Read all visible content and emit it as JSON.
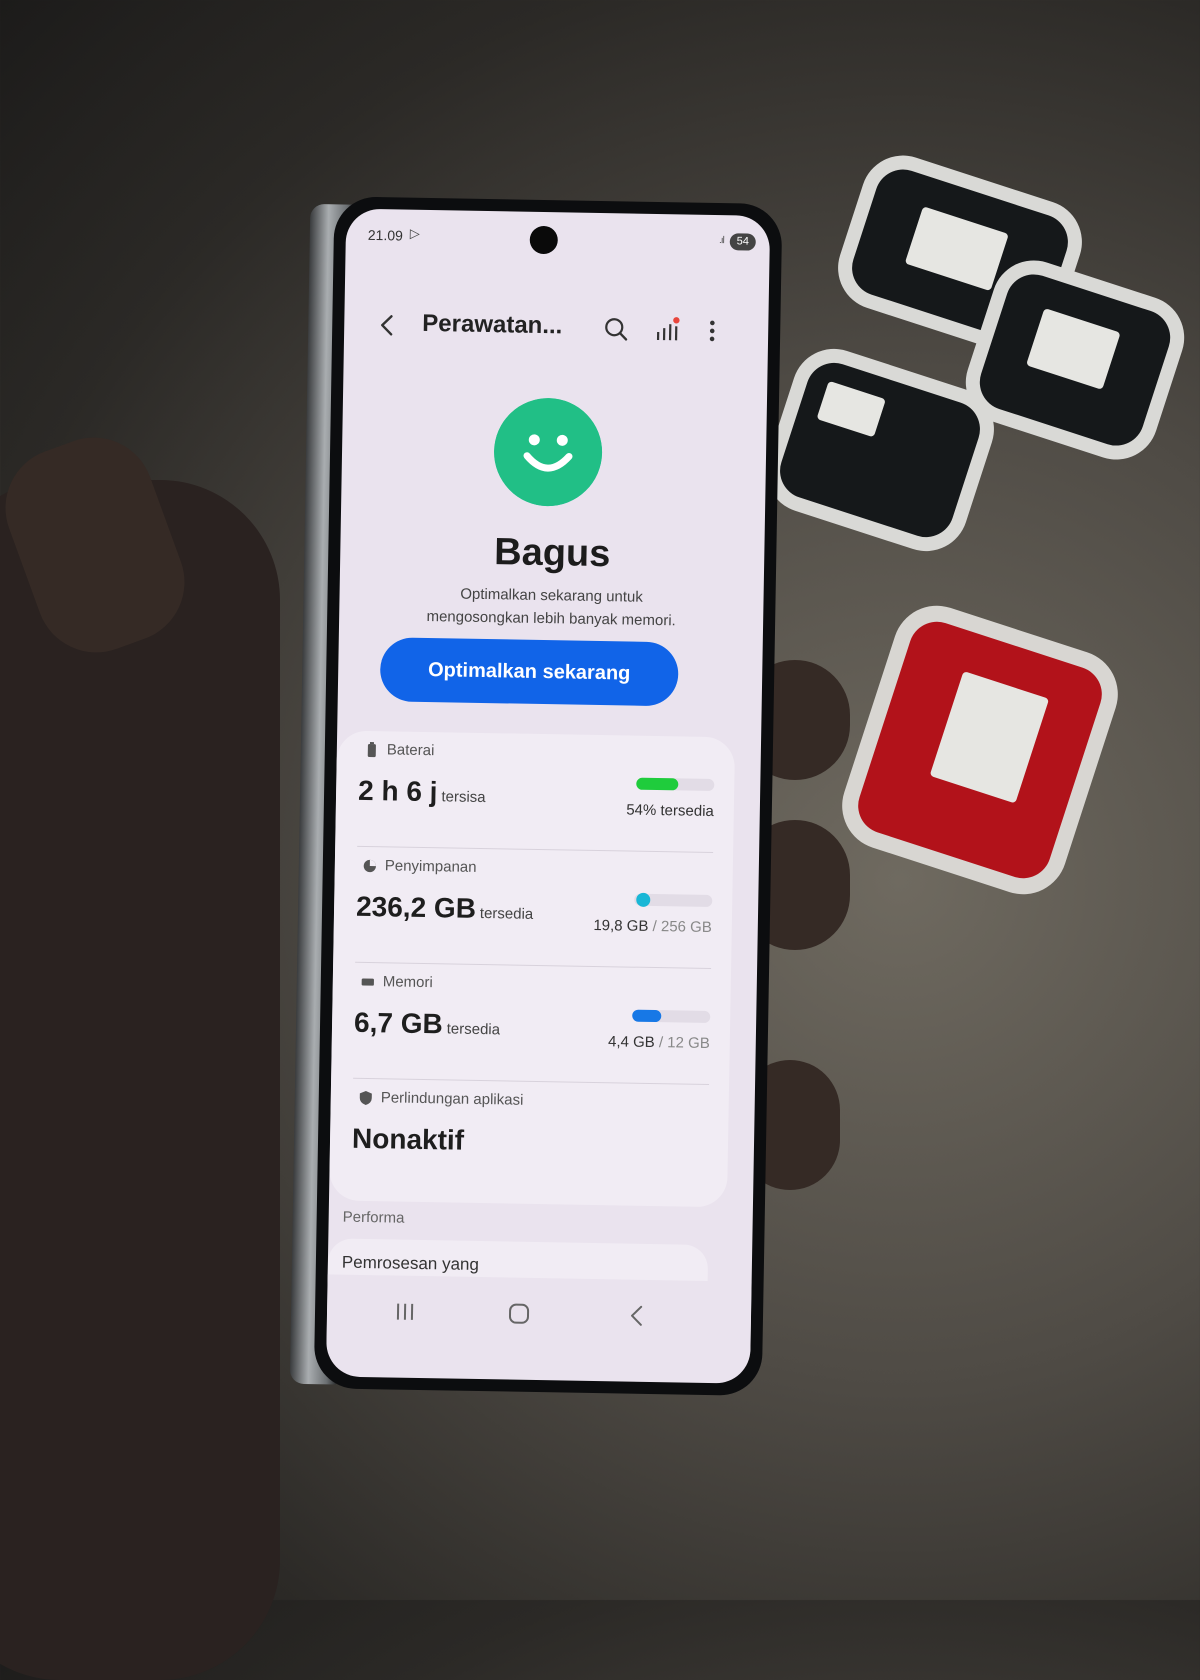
{
  "status_bar": {
    "time": "21.09",
    "battery_level": "54"
  },
  "app_bar": {
    "title": "Perawatan..."
  },
  "summary": {
    "status_word": "Bagus",
    "description_line1": "Optimalkan sekarang untuk",
    "description_line2": "mengosongkan lebih banyak memori.",
    "optimize_button": "Optimalkan sekarang"
  },
  "battery": {
    "label": "Baterai",
    "value": "2 h 6 j",
    "unit": "tersisa",
    "right_text": "54% tersedia",
    "level": 0.54,
    "color": "#1fcc3c"
  },
  "storage": {
    "label": "Penyimpanan",
    "value": "236,2 GB",
    "unit": "tersedia",
    "used": "19,8 GB",
    "total": "/ 256 GB",
    "level": 0.077,
    "color": "#19b7d6"
  },
  "memory": {
    "label": "Memori",
    "value": "6,7 GB",
    "unit": "tersedia",
    "used": "4,4 GB",
    "total": "/ 12 GB",
    "level": 0.37,
    "color": "#1778e6"
  },
  "app_protection": {
    "label": "Perlindungan aplikasi",
    "value": "Nonaktif"
  },
  "sections": {
    "performance_header": "Performa",
    "next_item_partial": "Pemrosesan yang"
  },
  "icons": [
    "back-icon",
    "search-icon",
    "bar-chart-icon",
    "more-vert-icon",
    "smiley-icon",
    "battery-icon",
    "storage-pie-icon",
    "memory-chip-icon",
    "shield-icon",
    "recents-icon",
    "home-icon",
    "nav-back-icon",
    "play-store-icon"
  ],
  "colors": {
    "accent": "#1164e8",
    "notification_dot": "#e8463c",
    "smiley_green": "#2cc87a"
  }
}
